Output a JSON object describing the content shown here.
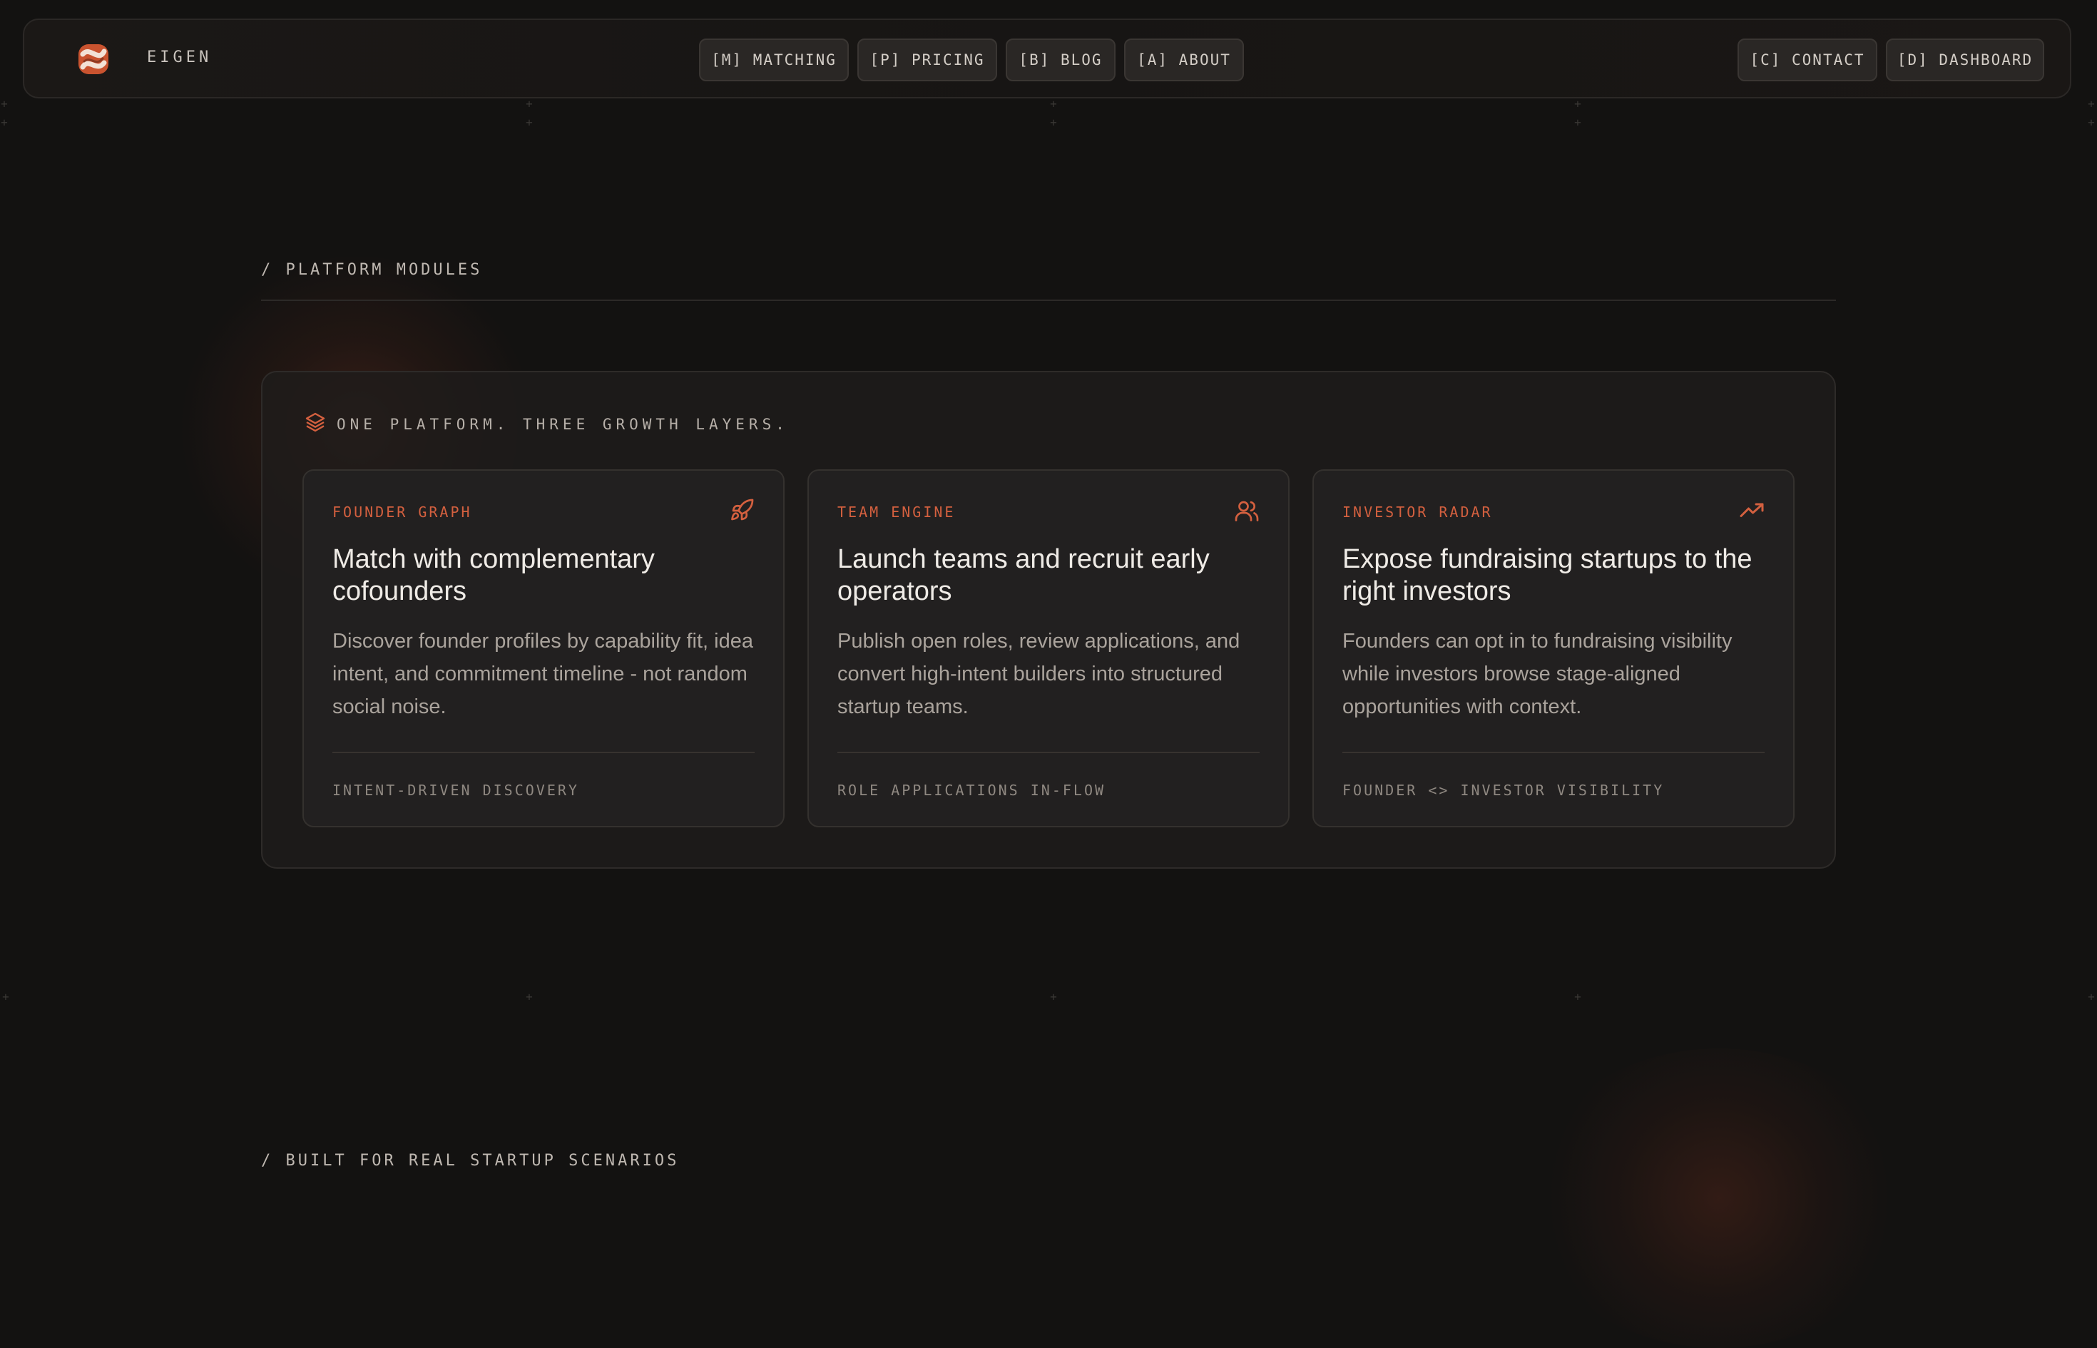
{
  "nav": {
    "brand": "EIGEN",
    "links": [
      {
        "label": "[M] MATCHING"
      },
      {
        "label": "[P] PRICING"
      },
      {
        "label": "[B] BLOG"
      },
      {
        "label": "[A] ABOUT"
      }
    ],
    "actions": [
      {
        "label": "[C] CONTACT"
      },
      {
        "label": "[D] DASHBOARD"
      }
    ]
  },
  "modules": {
    "section_label": "/ PLATFORM MODULES",
    "panel_heading": "ONE PLATFORM. THREE GROWTH LAYERS.",
    "panel_icon": "layers-icon",
    "cards": [
      {
        "kicker": "FOUNDER GRAPH",
        "icon": "rocket-icon",
        "title": "Match with complementary cofounders",
        "body": "Discover founder profiles by capability fit, idea intent, and commitment timeline - not random social noise.",
        "footer": "INTENT-DRIVEN DISCOVERY"
      },
      {
        "kicker": "TEAM ENGINE",
        "icon": "users-icon",
        "title": "Launch teams and recruit early operators",
        "body": "Publish open roles, review applications, and convert high-intent builders into structured startup teams.",
        "footer": "ROLE APPLICATIONS IN-FLOW"
      },
      {
        "kicker": "INVESTOR RADAR",
        "icon": "trending-up-icon",
        "title": "Expose fundraising startups to the right investors",
        "body": "Founders can opt in to fundraising visibility while investors browse stage-aligned opportunities with context.",
        "footer": "FOUNDER <> INVESTOR VISIBILITY"
      }
    ]
  },
  "scenarios": {
    "section_label": "/ BUILT FOR REAL STARTUP SCENARIOS"
  },
  "colors": {
    "background": "#131211",
    "accent": "#d4603f",
    "panel": "#1e1c1b",
    "card": "#222020"
  }
}
